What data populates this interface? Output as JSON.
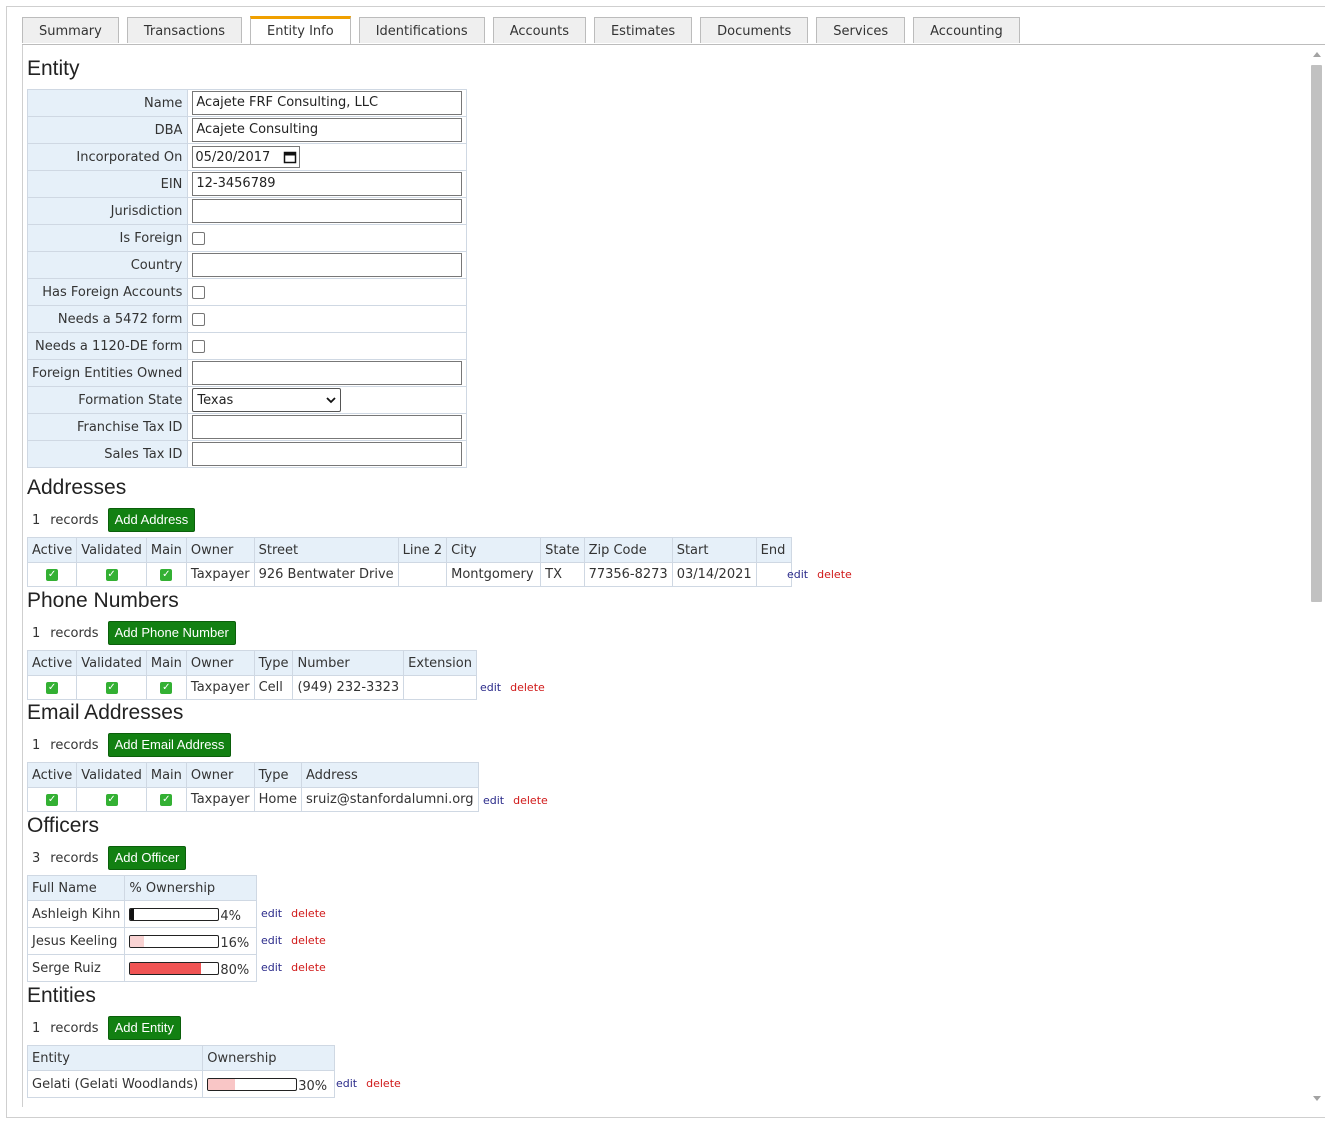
{
  "tabs": [
    "Summary",
    "Transactions",
    "Entity Info",
    "Identifications",
    "Accounts",
    "Estimates",
    "Documents",
    "Services",
    "Accounting"
  ],
  "active_tab": "Entity Info",
  "entity": {
    "title": "Entity",
    "name_label": "Name",
    "name_value": "Acajete FRF Consulting, LLC",
    "dba_label": "DBA",
    "dba_value": "Acajete Consulting",
    "incorporated_label": "Incorporated On",
    "incorporated_value": "05/20/2017",
    "ein_label": "EIN",
    "ein_value": "12-3456789",
    "jurisdiction_label": "Jurisdiction",
    "jurisdiction_value": "",
    "is_foreign_label": "Is Foreign",
    "country_label": "Country",
    "country_value": "",
    "has_foreign_accounts_label": "Has Foreign Accounts",
    "needs_5472_label": "Needs a 5472 form",
    "needs_1120_label": "Needs a 1120-DE form",
    "foreign_entities_label": "Foreign Entities Owned",
    "foreign_entities_value": "",
    "formation_state_label": "Formation State",
    "formation_state_value": "Texas",
    "franchise_tax_label": "Franchise Tax ID",
    "franchise_tax_value": "",
    "sales_tax_label": "Sales Tax ID",
    "sales_tax_value": ""
  },
  "common": {
    "records_word": "records",
    "edit": "edit",
    "delete": "delete"
  },
  "addresses": {
    "title": "Addresses",
    "count": "1",
    "add_label": "Add Address",
    "columns": [
      "Active",
      "Validated",
      "Main",
      "Owner",
      "Street",
      "Line 2",
      "City",
      "State",
      "Zip Code",
      "Start",
      "End"
    ],
    "rows": [
      {
        "owner": "Taxpayer",
        "street": "926 Bentwater Drive",
        "line2": "",
        "city": "Montgomery",
        "state": "TX",
        "zip": "77356-8273",
        "start": "03/14/2021",
        "end": ""
      }
    ]
  },
  "phones": {
    "title": "Phone Numbers",
    "count": "1",
    "add_label": "Add Phone Number",
    "columns": [
      "Active",
      "Validated",
      "Main",
      "Owner",
      "Type",
      "Number",
      "Extension"
    ],
    "rows": [
      {
        "owner": "Taxpayer",
        "type": "Cell",
        "number": "(949) 232-3323",
        "extension": ""
      }
    ]
  },
  "emails": {
    "title": "Email Addresses",
    "count": "1",
    "add_label": "Add Email Address",
    "columns": [
      "Active",
      "Validated",
      "Main",
      "Owner",
      "Type",
      "Address"
    ],
    "rows": [
      {
        "owner": "Taxpayer",
        "type": "Home",
        "address": "sruiz@stanfordalumni.org"
      }
    ]
  },
  "officers": {
    "title": "Officers",
    "count": "3",
    "add_label": "Add Officer",
    "columns": [
      "Full Name",
      "% Ownership"
    ],
    "rows": [
      {
        "name": "Ashleigh Kihn",
        "pct_label": "4%",
        "fraction": 0.04,
        "color": "#111111"
      },
      {
        "name": "Jesus Keeling",
        "pct_label": "16%",
        "fraction": 0.16,
        "color": "#f9d3d3"
      },
      {
        "name": "Serge Ruiz",
        "pct_label": "80%",
        "fraction": 0.8,
        "color": "#f05454"
      }
    ]
  },
  "entities": {
    "title": "Entities",
    "count": "1",
    "add_label": "Add Entity",
    "columns": [
      "Entity",
      "Ownership"
    ],
    "rows": [
      {
        "name": "Gelati (Gelati Woodlands)",
        "pct_label": "30%",
        "fraction": 0.3,
        "color": "#f9c6c6"
      }
    ]
  },
  "colors": {
    "accent_tab": "#f0a000",
    "add_button": "#128012",
    "header_bg": "#e6f0f9",
    "check": "#33b033"
  }
}
